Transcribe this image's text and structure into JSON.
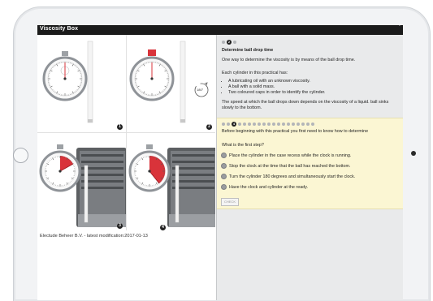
{
  "app": {
    "title": "Viscosity Box"
  },
  "images": [
    {
      "number": "1"
    },
    {
      "number": "2",
      "rotation_label": "180°"
    },
    {
      "number": "3"
    },
    {
      "number": "4"
    }
  ],
  "credit": "Electude Beheer B.V. - latest modification:2017-01-13",
  "lesson": {
    "pager": {
      "total": 3,
      "current": 2,
      "current_label": "2"
    },
    "heading": "Determine ball drop time",
    "intro": "One way to determine the viscosity is by means of the ball drop time.",
    "list_intro": "Each cylinder in this practical has:",
    "items": [
      "A lubricating oil with an unknown viscosity.",
      "A ball with a solid mass.",
      "Two coloured caps in order to identify the cylinder."
    ],
    "speed_text": "The speed at which the ball drops down depends on the viscosity of a liquid. ball sinks slowly to the bottom."
  },
  "quiz": {
    "pager": {
      "total": 19,
      "current": 3,
      "current_label": "4"
    },
    "intro": "Before beginning with this practical you first need to know how to determine",
    "question": "What is the first step?",
    "options": [
      "Place the cylinder in the case recess while the clock is running.",
      "Stop the clock at the time that the ball has reached the bottom.",
      "Turn the cylinder 180 degrees and simultaneously start the clock.",
      "Have the clock and cylinder at the ready."
    ],
    "check_label": "CHECK"
  },
  "colors": {
    "accent_red": "#d9333a",
    "topbar": "#1b1b1b",
    "quiz_bg": "#fbf6d3"
  }
}
